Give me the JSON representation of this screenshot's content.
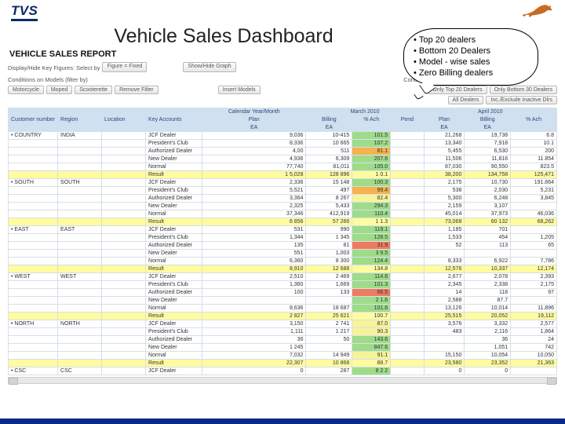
{
  "brand": "TVS",
  "page_title": "Vehicle Sales Dashboard",
  "report_title": "VEHICLE SALES REPORT",
  "callout": {
    "a": "Top  20 dealers",
    "b": "Bottom 20 Dealers",
    "c": "Model - wise sales",
    "d": "Zero Billing dealers"
  },
  "controls": {
    "kf_label": "Display/Hide Key Figures: Select by",
    "kf_btn": "Figure = Fixed",
    "showhide": "Show/Hide Graph",
    "cond_models": "Conditions on Models (filter by)",
    "cond_dealers": "Conditions on Dealers",
    "model_btns": [
      "Motorcycle",
      "Moped",
      "Scooterette",
      "Remove Filter"
    ],
    "model_btn_right": "Insert Models",
    "dealer_btns": [
      "Only Top 20 Dealers",
      "Only Bottom 30 Dealers"
    ],
    "dealer_btns2": [
      "All Dealers",
      "Inc./Exclude Inactive Dlrs"
    ]
  },
  "cols": {
    "dim": [
      "Customer number",
      "Region",
      "Location",
      "Key Accounts"
    ],
    "month1": "March 2010",
    "month2": "April 2010",
    "metrics": [
      "Plan",
      "Billing",
      "% Ach",
      "Pend",
      "Plan",
      "Billing",
      "% Ach"
    ],
    "unit": "EA"
  },
  "rows": [
    {
      "d": [
        "• COUNTRY",
        "INDIA",
        "",
        "JCF Dealer"
      ],
      "v": [
        "9,036",
        "10-415",
        "101.5",
        "",
        "21,268",
        "19,738",
        "6.8"
      ],
      "c": "rgreen"
    },
    {
      "d": [
        "",
        "",
        "",
        "President's Club"
      ],
      "v": [
        "8,336",
        "10 665",
        "107.2",
        "",
        "13,340",
        "7,918",
        "10.1"
      ],
      "c": "rgreen"
    },
    {
      "d": [
        "",
        "",
        "",
        "Authorized Dealer"
      ],
      "v": [
        "4,00",
        "511",
        "81.1",
        "",
        "5,455",
        "6,530",
        "200"
      ],
      "c": "rorange"
    },
    {
      "d": [
        "",
        "",
        "",
        "New Dealer"
      ],
      "v": [
        "4,936",
        "6,309",
        "207.6",
        "",
        "11,506",
        "11,816",
        "11.854"
      ],
      "c": "rgreen"
    },
    {
      "d": [
        "",
        "",
        "",
        "Normal"
      ],
      "v": [
        "77,740",
        "81,011",
        "105.0",
        "",
        "87,030",
        "90,550",
        "823.5"
      ],
      "c": "rgreen"
    },
    {
      "d": [
        "",
        "",
        "",
        "Result"
      ],
      "v": [
        "1 5,028",
        "128 896",
        "1 0.1",
        "",
        "38,200",
        "134,758",
        "125,471"
      ],
      "c": "rres"
    },
    {
      "d": [
        "• SOUTH",
        "SOUTH",
        "",
        "JCF Dealer"
      ],
      "v": [
        "2,336",
        "15 148",
        "100.3",
        "",
        "2,175",
        "10,730",
        "191.864"
      ],
      "c": "rgreen"
    },
    {
      "d": [
        "",
        "",
        "",
        "President's Club"
      ],
      "v": [
        "5,521",
        "497",
        "99.4",
        "",
        "538",
        "2,030",
        "5,231"
      ],
      "c": "rorange"
    },
    {
      "d": [
        "",
        "",
        "",
        "Authorized Dealer"
      ],
      "v": [
        "3,364",
        "8 267",
        "82.4",
        "",
        "5,300",
        "6,248",
        "3,845"
      ],
      "c": "ryellow"
    },
    {
      "d": [
        "",
        "",
        "",
        "New Dealer"
      ],
      "v": [
        "2,325",
        "5,433",
        "294.3",
        "",
        "2,159",
        "3,107",
        ""
      ],
      "c": "rgreen"
    },
    {
      "d": [
        "",
        "",
        "",
        "Normal"
      ],
      "v": [
        "37,346",
        "412,919",
        "110.4",
        "",
        "45,014",
        "37,973",
        "46,036"
      ],
      "c": "rgreen"
    },
    {
      "d": [
        "",
        "",
        "",
        "Result"
      ],
      "v": [
        "6 856",
        "57 266",
        "1 1.3",
        "",
        "73,068",
        "60 132",
        "68,262"
      ],
      "c": "rres"
    },
    {
      "d": [
        "• EAST",
        "EAST",
        "",
        "JCF Dealer"
      ],
      "v": [
        "531",
        "990",
        "119.1",
        "",
        "1,185",
        "701",
        ""
      ],
      "c": "rgreen"
    },
    {
      "d": [
        "",
        "",
        "",
        "President's Club"
      ],
      "v": [
        "1,344",
        "1 345",
        "128.5",
        "",
        "1,533",
        "454",
        "1,205"
      ],
      "c": "rgreen"
    },
    {
      "d": [
        "",
        "",
        "",
        "Authorized Dealer"
      ],
      "v": [
        "135",
        "81",
        "31.9",
        "",
        "52",
        "113",
        "65"
      ],
      "c": "rred"
    },
    {
      "d": [
        "",
        "",
        "",
        "New Dealer"
      ],
      "v": [
        "551",
        "1,003",
        "3 9.5",
        "",
        "",
        "",
        ""
      ],
      "c": "rgreen"
    },
    {
      "d": [
        "",
        "",
        "",
        "Normal"
      ],
      "v": [
        "6,360",
        "8 300",
        "124.4",
        "",
        "8,333",
        "6,922",
        "7,786"
      ],
      "c": "rgreen"
    },
    {
      "d": [
        "",
        "",
        "",
        "Result"
      ],
      "v": [
        "8,910",
        "12 688",
        "134.8",
        "",
        "12,576",
        "10,337",
        "12,174"
      ],
      "c": "rres"
    },
    {
      "d": [
        "• WEST",
        "WEST",
        "",
        "JCF Dealer"
      ],
      "v": [
        "2,510",
        "2 469",
        "114.6",
        "",
        "2,677",
        "2,078",
        "2,393"
      ],
      "c": "rgreen"
    },
    {
      "d": [
        "",
        "",
        "",
        "President's Club"
      ],
      "v": [
        "1,360",
        "1,669",
        "101.3",
        "",
        "2,345",
        "2,338",
        "2,175"
      ],
      "c": "rgreen"
    },
    {
      "d": [
        "",
        "",
        "",
        "Authorized Dealer"
      ],
      "v": [
        "100",
        "133",
        "66.5",
        "",
        "14",
        "118",
        "97"
      ],
      "c": "rred"
    },
    {
      "d": [
        "",
        "",
        "",
        "New Dealer"
      ],
      "v": [
        "",
        "",
        "2 1.6",
        "",
        "2,588",
        "87.7",
        ""
      ],
      "c": "rgreen"
    },
    {
      "d": [
        "",
        "",
        "",
        "Normal"
      ],
      "v": [
        "8,636",
        "18 687",
        "101.6",
        "",
        "13,126",
        "10,014",
        "11,896"
      ],
      "c": "rgreen"
    },
    {
      "d": [
        "",
        "",
        "",
        "Result"
      ],
      "v": [
        "2 827",
        "25 621",
        "100.7",
        "",
        "25,515",
        "20,052",
        "19,112"
      ],
      "c": "rres"
    },
    {
      "d": [
        "• NORTH",
        "NORTH",
        "",
        "JCF Dealer"
      ],
      "v": [
        "3,150",
        "2 741",
        "87.0",
        "",
        "3,576",
        "3,332",
        "2,577"
      ],
      "c": "ryellow"
    },
    {
      "d": [
        "",
        "",
        "",
        "President's Club"
      ],
      "v": [
        "1,111",
        "1 217",
        "90.3",
        "",
        "483",
        "2,116",
        "1,864"
      ],
      "c": "ryellow"
    },
    {
      "d": [
        "",
        "",
        "",
        "Authorized Dealer"
      ],
      "v": [
        "36",
        "50",
        "143.6",
        "",
        "",
        "36",
        "24"
      ],
      "c": "rgreen"
    },
    {
      "d": [
        "",
        "",
        "",
        "New Dealer"
      ],
      "v": [
        "1 245",
        "",
        "847.6",
        "",
        "",
        "1,051",
        "742"
      ],
      "c": "rgreen"
    },
    {
      "d": [
        "",
        "",
        "",
        "Normal"
      ],
      "v": [
        "7,032",
        "14 949",
        "91.1",
        "",
        "15,150",
        "10,054",
        "10,050"
      ],
      "c": "ryellow"
    },
    {
      "d": [
        "",
        "",
        "",
        "Result"
      ],
      "v": [
        "22,307",
        "10 868",
        "88.7",
        "",
        "23,580",
        "23,352",
        "21,363"
      ],
      "c": "rres"
    },
    {
      "d": [
        "• CSC",
        "CSC",
        "",
        "JCF Dealer"
      ],
      "v": [
        "0",
        "287",
        "8 2 2",
        "",
        "0",
        "0",
        ""
      ],
      "c": "rgreen"
    }
  ]
}
